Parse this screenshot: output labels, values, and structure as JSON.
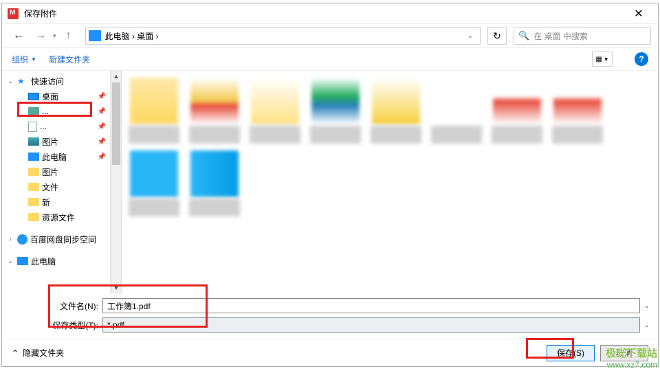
{
  "title": "保存附件",
  "nav": {
    "path_text": "此电脑 › 桌面 ›",
    "refresh": "↻"
  },
  "search": {
    "placeholder": "在 桌面 中搜索"
  },
  "toolbar": {
    "organize": "组织",
    "newfolder": "新建文件夹"
  },
  "tree": {
    "quick_access": "快速访问",
    "desktop": "桌面",
    "downloads": "...",
    "documents": "...",
    "pictures": "图片",
    "this_pc": "此电脑",
    "folder_pictures": "图片",
    "folder_files": "文件",
    "folder_new": "新",
    "folder_res": "资源文件",
    "baidu": "百度网盘同步空间",
    "this_pc2": "此电脑"
  },
  "form": {
    "filename_label": "文件名(N):",
    "filename_value": "工作簿1.pdf",
    "filetype_label": "保存类型(T):",
    "filetype_value": "*.pdf"
  },
  "footer": {
    "hide_folders": "隐藏文件夹",
    "save": "保存(S)",
    "cancel": "取消"
  },
  "watermark": {
    "line1": "极光下载站",
    "line2": "www.xz7.com"
  }
}
